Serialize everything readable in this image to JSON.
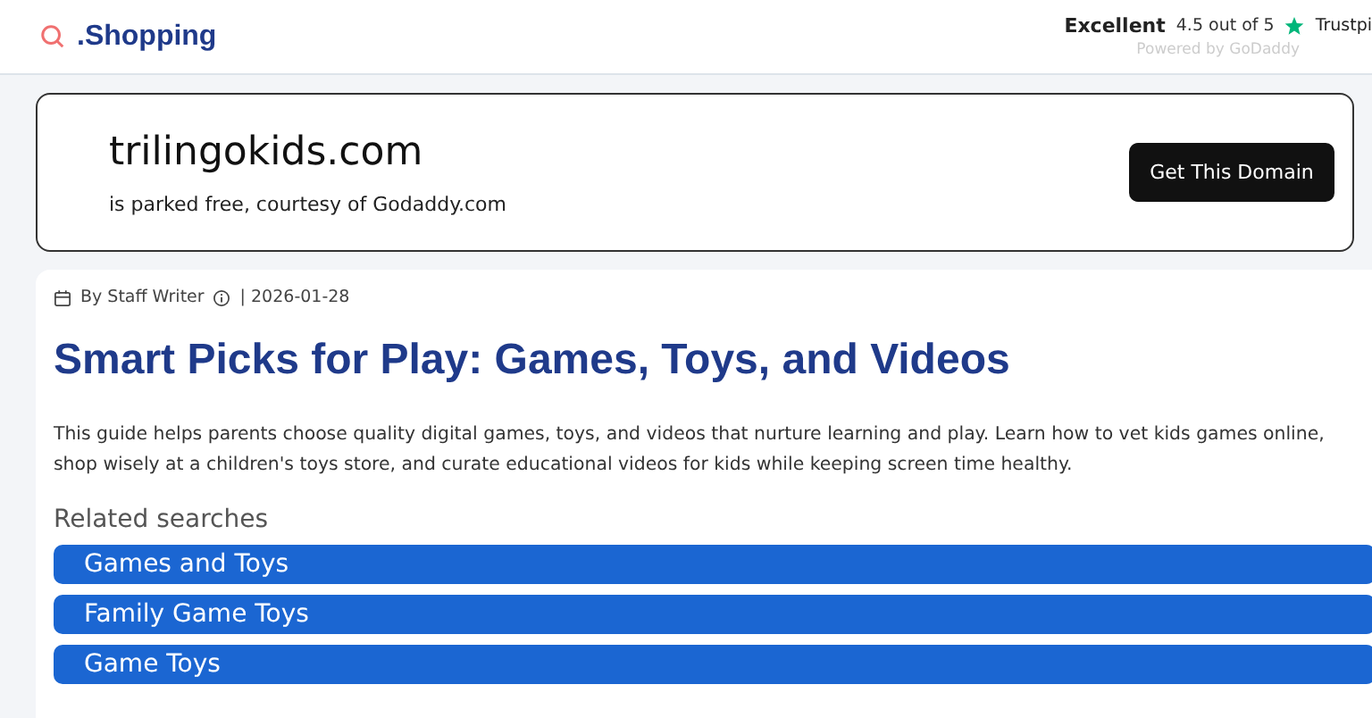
{
  "header": {
    "logo": ".Shopping",
    "rating": {
      "label": "Excellent",
      "score": "4.5 out of 5",
      "brand": "Trustpi",
      "powered": "Powered by GoDaddy"
    }
  },
  "domain_card": {
    "domain": "trilingokids.com",
    "subtitle": "is parked free, courtesy of Godaddy.com",
    "button": "Get This Domain"
  },
  "article": {
    "author": "By Staff Writer",
    "date": "| 2026-01-28",
    "title": "Smart Picks for Play: Games, Toys, and Videos",
    "body": "This guide helps parents choose quality digital games, toys, and videos that nurture learning and play. Learn how to vet kids games online, shop wisely at a children's toys store, and curate educational videos for kids while keeping screen time healthy.",
    "related_title": "Related searches",
    "related": [
      {
        "label": "Games and Toys"
      },
      {
        "label": "Family Game Toys"
      },
      {
        "label": "Game Toys"
      }
    ]
  }
}
